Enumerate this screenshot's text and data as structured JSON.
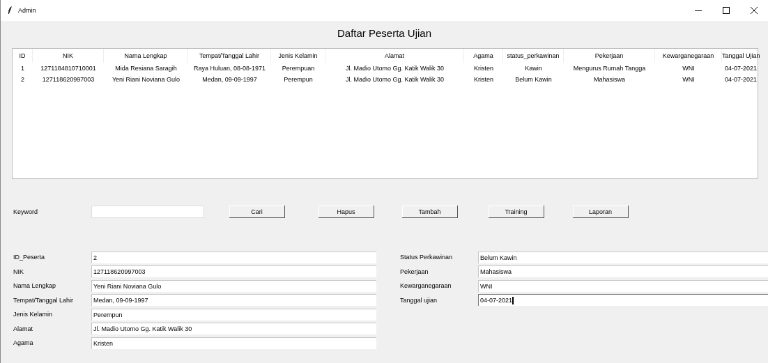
{
  "window": {
    "title": "Admin"
  },
  "heading": "Daftar Peserta Ujian",
  "table": {
    "columns": [
      "ID",
      "NIK",
      "Nama Lengkap",
      "Tempat/Tanggal Lahir",
      "Jenis Kelamin",
      "Alamat",
      "Agama",
      "status_perkawinan",
      "Pekerjaan",
      "Kewarganegaraan",
      "Tanggal Ujian"
    ],
    "rows": [
      [
        "1",
        "1271184810710001",
        "Mida Resiana Saragih",
        "Raya Huluan, 08-08-1971",
        "Perempuan",
        "Jl. Madio Utomo Gg. Katik Walik 30",
        "Kristen",
        "Kawin",
        "Mengurus Rumah Tangga",
        "WNI",
        "04-07-2021"
      ],
      [
        "2",
        "127118620997003",
        "Yeni Riani Noviana Gulo",
        "Medan, 09-09-1997",
        "Perempun",
        "Jl. Madio Utomo Gg. Katik Walik 30",
        "Kristen",
        "Belum Kawin",
        "Mahasiswa",
        "WNI",
        "04-07-2021"
      ]
    ]
  },
  "search": {
    "label": "Keyword"
  },
  "buttons": [
    "Cari",
    "Hapus",
    "Tambah",
    "Training",
    "Laporan"
  ],
  "form_left": [
    {
      "label": "ID_Peserta",
      "value": "2",
      "focused": false
    },
    {
      "label": "NIK",
      "value": "127118620997003",
      "focused": false
    },
    {
      "label": "Nama Lengkap",
      "value": "Yeni Riani Noviana Gulo",
      "focused": false
    },
    {
      "label": "Tempat/Tanggal Lahir",
      "value": "Medan, 09-09-1997",
      "focused": false
    },
    {
      "label": "Jenis Kelamin",
      "value": "Perempun",
      "focused": false
    },
    {
      "label": "Alamat",
      "value": "Jl. Madio Utomo Gg. Katik Walik 30",
      "focused": false
    },
    {
      "label": "Agama",
      "value": "Kristen",
      "focused": false
    }
  ],
  "form_right": [
    {
      "label": "Status Perkawinan",
      "value": "Belum Kawin",
      "focused": false
    },
    {
      "label": "Pekerjaan",
      "value": "Mahasiswa",
      "focused": false
    },
    {
      "label": "Kewarganegaraan",
      "value": "WNI",
      "focused": false
    },
    {
      "label": "Tanggal ujian",
      "value": "04-07-2021",
      "focused": true
    }
  ]
}
